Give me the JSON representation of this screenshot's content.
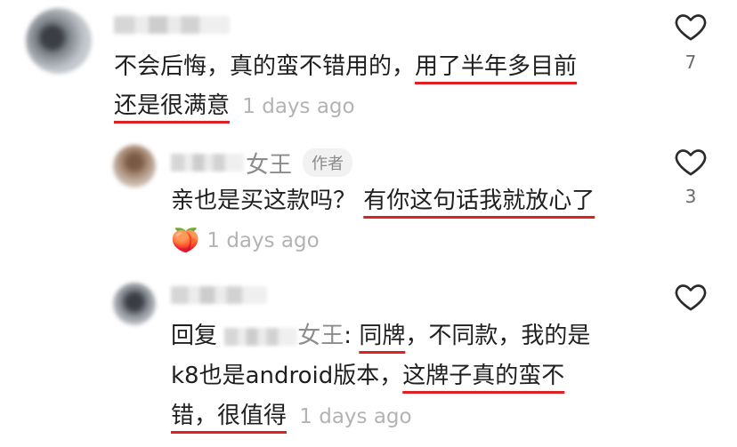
{
  "comments": [
    {
      "text_line1_plain": "不会后悔，真的蛮不错用的，",
      "text_line1_mark": "用了半年多目前",
      "text_line2_mark": "还是很满意",
      "time": "1 days ago",
      "likes": "7"
    },
    {
      "name_suffix": "女王",
      "badge": "作者",
      "text_plain": "亲也是买这款吗？ ",
      "text_mark": "有你这句话我就放心了",
      "emoji": "🍑",
      "time": "1 days ago",
      "likes": "3"
    },
    {
      "reply_prefix": "回复 ",
      "reply_to_suffix": "女王",
      "reply_colon": ": ",
      "line1_mark": "同牌",
      "line1_plain": "，不同款，我的是",
      "line2_plain": "k8也是android版本，",
      "line2_mark": "这牌子真的蛮不",
      "line3_mark": "错，很值得",
      "time": "1 days ago"
    }
  ],
  "colors": {
    "underline": "#e02020",
    "meta": "#b3b3b3"
  }
}
